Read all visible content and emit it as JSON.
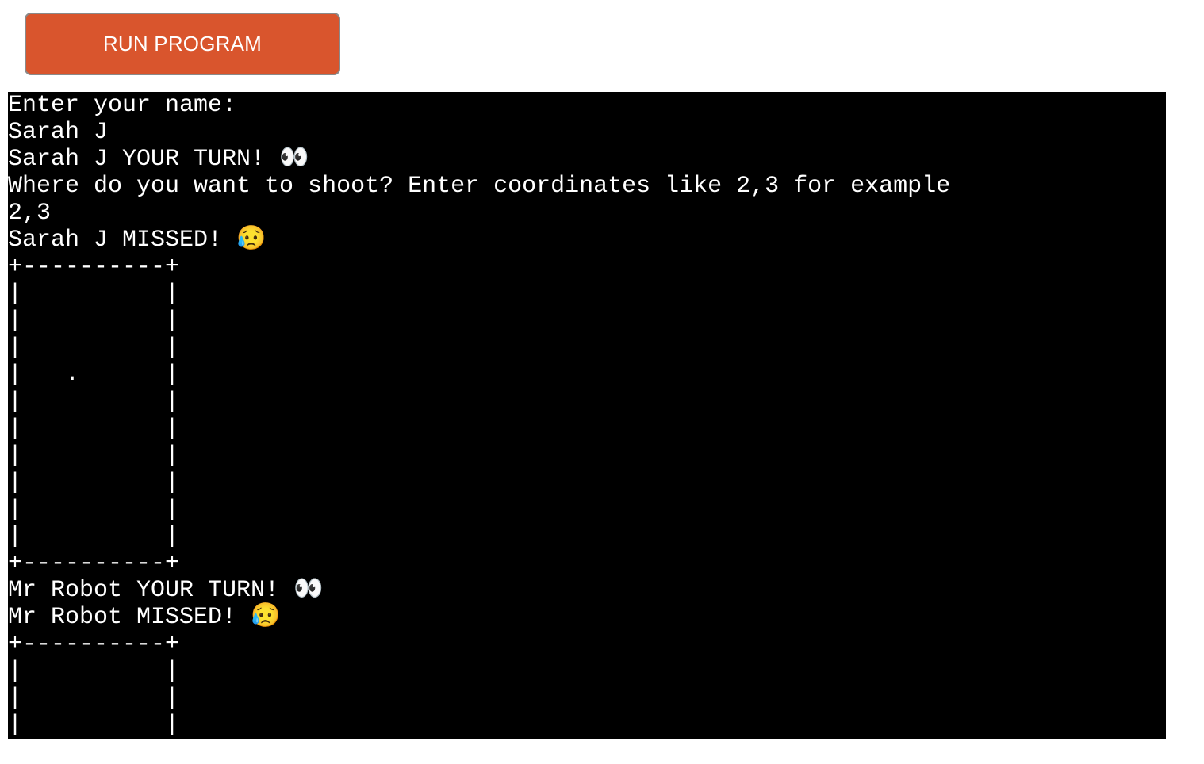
{
  "toolbar": {
    "run_label": "RUN PROGRAM",
    "run_color": "#d9552d"
  },
  "terminal": {
    "background": "#000000",
    "foreground": "#ffffff",
    "lines": [
      "Enter your name:",
      "Sarah J",
      "Sarah J YOUR TURN! 👀",
      "Where do you want to shoot? Enter coordinates like 2,3 for example",
      "2,3",
      "Sarah J MISSED! 😥",
      "+----------+",
      "|          |",
      "|          |",
      "|          |",
      "|   .      |",
      "|          |",
      "|          |",
      "|          |",
      "|          |",
      "|          |",
      "|          |",
      "+----------+",
      "Mr Robot YOUR TURN! 👀",
      "Mr Robot MISSED! 😥",
      "+----------+",
      "|          |",
      "|          |",
      "|          |"
    ]
  }
}
